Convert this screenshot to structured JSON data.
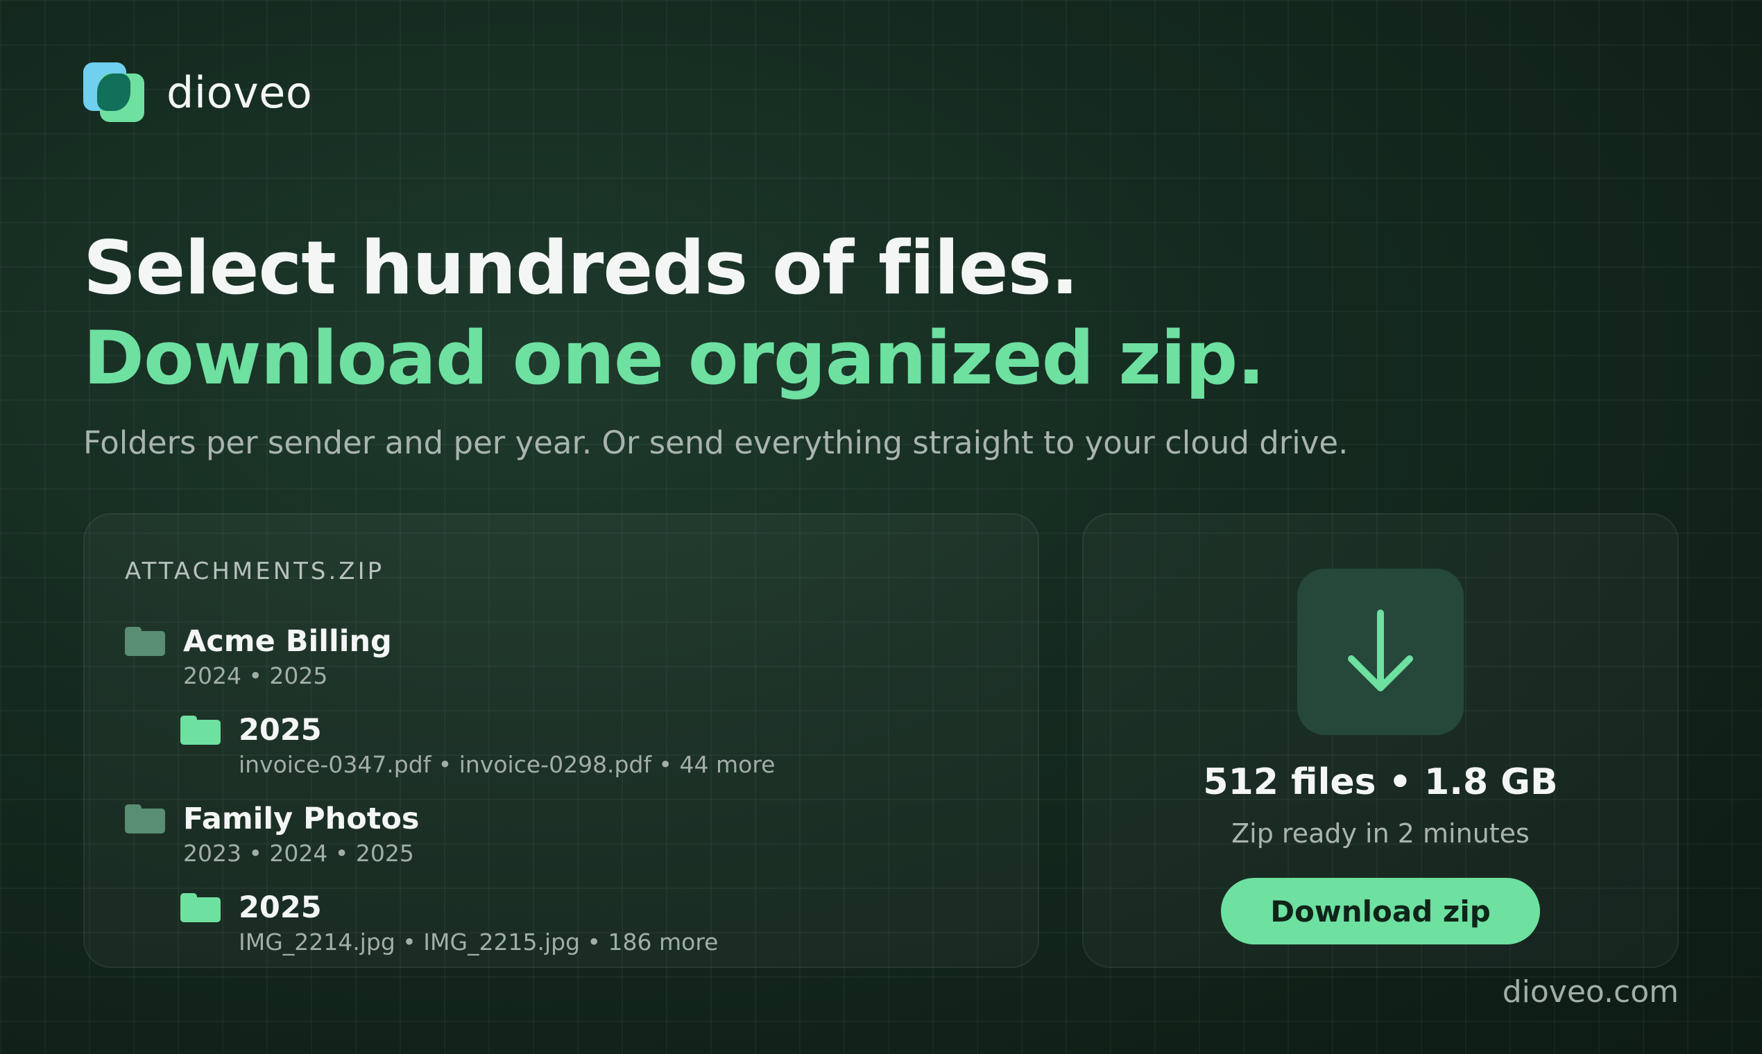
{
  "brand": {
    "name": "dioveo",
    "url": "dioveo.com"
  },
  "hero": {
    "headline_white": "Select hundreds of files.",
    "headline_green": "Download one organized zip.",
    "subtitle": "Folders per sender and per year. Or send everything straight to your cloud drive."
  },
  "zip": {
    "name": "ATTACHMENTS.ZIP",
    "folders": [
      {
        "name": "Acme Billing",
        "years": "2024 • 2025",
        "icon": "folder-icon",
        "child": {
          "name": "2025",
          "files": "invoice-0347.pdf • invoice-0298.pdf • 44 more",
          "icon": "folder-icon"
        }
      },
      {
        "name": "Family Photos",
        "years": "2023 • 2024 • 2025",
        "icon": "folder-icon",
        "child": {
          "name": "2025",
          "files": "IMG_2214.jpg • IMG_2215.jpg • 186 more",
          "icon": "folder-icon"
        }
      }
    ]
  },
  "download": {
    "icon": "download-arrow-icon",
    "stats": "512 files • 1.8 GB",
    "status": "Zip ready in 2 minutes",
    "button_label": "Download zip"
  },
  "colors": {
    "accent": "#6ee0a0",
    "background": "#14291f",
    "folder_muted": "#5a8e72"
  }
}
